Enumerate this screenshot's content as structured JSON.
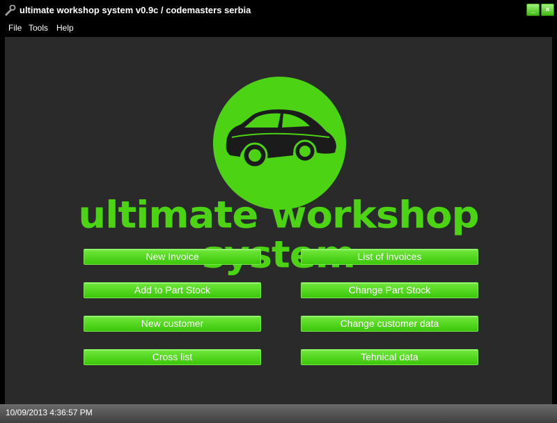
{
  "window": {
    "title": "ultimate workshop system v0.9c / codemasters serbia",
    "minimize_glyph": "_",
    "close_glyph": "×"
  },
  "menu": {
    "items": [
      "File",
      "Tools",
      "Help"
    ]
  },
  "logo": {
    "brand_text": "ultimate workshop system",
    "icon": "car-icon",
    "accent_color": "#4cd314"
  },
  "buttons": {
    "new_invoice": "New Invoice",
    "list_of_invoices": "List of invoices",
    "add_to_part_stock": "Add to Part Stock",
    "change_part_stock": "Change Part Stock",
    "new_customer": "New customer",
    "change_customer_data": "Change customer data",
    "cross_list": "Cross list",
    "tehnical_data": "Tehnical data"
  },
  "status": {
    "datetime": "10/09/2013 4:36:57 PM"
  }
}
